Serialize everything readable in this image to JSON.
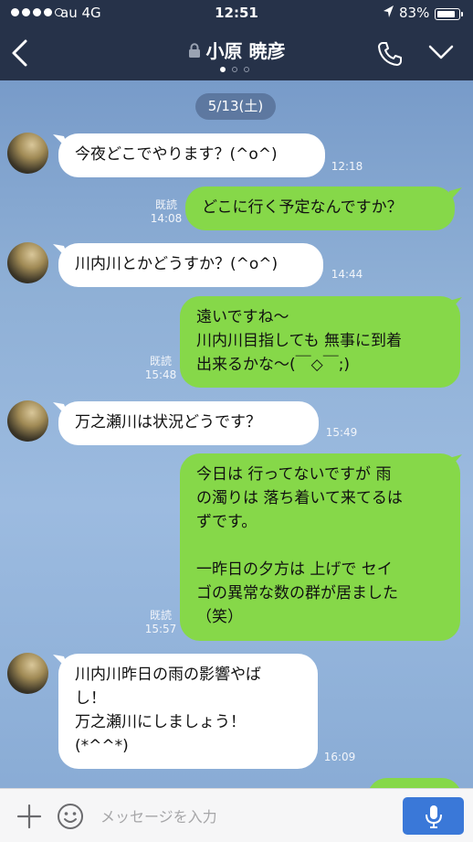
{
  "status": {
    "carrier": "au  4G",
    "time": "12:51",
    "battery": "83%"
  },
  "header": {
    "title": "小原 暁彦"
  },
  "date_label": "5/13(土)",
  "messages": [
    {
      "dir": "in",
      "text": "今夜どこでやります？(^o^)",
      "time": "12:18"
    },
    {
      "dir": "out",
      "text": "どこに行く予定なんですか？",
      "read": "既読",
      "time": "14:08"
    },
    {
      "dir": "in",
      "text": "川内川とかどうすか？(^o^)",
      "time": "14:44"
    },
    {
      "dir": "out",
      "text": "遠いですね〜\n川内川目指しても 無事に到着\n出来るかな〜(￣◇￣;)",
      "read": "既読",
      "time": "15:48"
    },
    {
      "dir": "in",
      "text": "万之瀬川は状況どうです？",
      "time": "15:49"
    },
    {
      "dir": "out",
      "text": "今日は 行ってないですが 雨\nの濁りは 落ち着いて来てるは\nずです。\n\n一昨日の夕方は 上げで セイ\nゴの異常な数の群が居ました\n（笑）",
      "read": "既読",
      "time": "15:57"
    },
    {
      "dir": "in",
      "text": "川内川昨日の雨の影響やば\nし！\n万之瀬川にしましょう！\n(*^^*)",
      "time": "16:09"
    }
  ],
  "input": {
    "placeholder": "メッセージを入力"
  },
  "colors": {
    "header_bg": "#263249",
    "outgoing_bubble": "#86d849",
    "incoming_bubble": "#ffffff",
    "mic_button": "#3a78d8"
  }
}
